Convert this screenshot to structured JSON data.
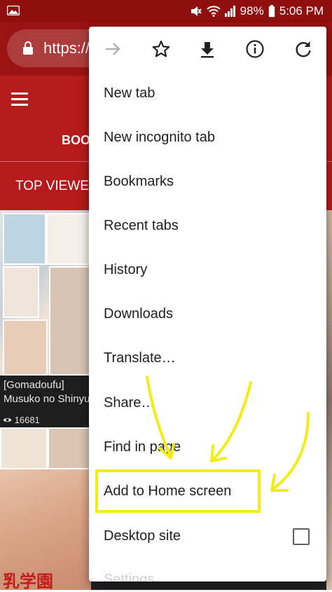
{
  "status_bar": {
    "battery": "98%",
    "time": "5:06 PM"
  },
  "browser": {
    "url_partial": "https://"
  },
  "site": {
    "nav_tab_partial": "BOO",
    "section_partial": "TOP VIEWE",
    "gallery": [
      {
        "caption_line1": "[Gomadoufu]",
        "caption_line2": "Musuko no Shinyu",
        "views": "16681"
      }
    ],
    "thumb2_label": "乳学園"
  },
  "menu": {
    "icons": [
      "forward-icon",
      "star-icon",
      "download-icon",
      "info-icon",
      "refresh-icon"
    ],
    "items": [
      {
        "label": "New tab"
      },
      {
        "label": "New incognito tab"
      },
      {
        "label": "Bookmarks"
      },
      {
        "label": "Recent tabs"
      },
      {
        "label": "History"
      },
      {
        "label": "Downloads"
      },
      {
        "label": "Translate…"
      },
      {
        "label": "Share…"
      },
      {
        "label": "Find in page"
      },
      {
        "label": "Add to Home screen"
      },
      {
        "label": "Desktop site"
      },
      {
        "label": "Settings"
      }
    ]
  },
  "colors": {
    "status_bar": "#8f0e0e",
    "toolbar": "#9b1212",
    "site_header": "#b51b1b",
    "annotation": "#f4ec17"
  }
}
